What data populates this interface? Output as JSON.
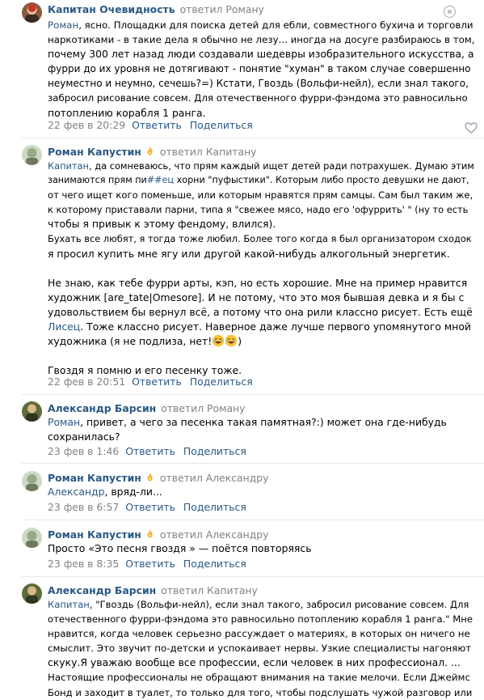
{
  "comments": [
    {
      "author": "Капитан Очевидность",
      "replied": "ответил Роману",
      "addressee": "Роман",
      "lines": [
        ", ясно. Площадки для поиска детей для ебли, совместного бухича и торговли",
        "наркотиками - в такие дела я обычно не лезу... иногда на досуге разбираюсь в том,",
        "почему 300 лет назад люди создавали шедевры изобразительного искусства, а",
        "фурри до их уровня не дотягивают - понятие \"хуман\" в таком случае совершенно",
        "неуместно и неумно, сечешь?=) Кстати, Гвоздь (Вольфи-нейл), если знал такого,",
        "забросил рисование совсем. Для отечественного фурри-фэндома это равносильно",
        "потоплению корабля 1 ранга."
      ],
      "date": "22 фев в 20:29",
      "reply": "Ответить",
      "share": "Поделиться"
    },
    {
      "author": "Роман Капустин",
      "replied": "ответил Капитану",
      "addressee": "Капитан",
      "line1_a": ", да сомневаюсь, что прям каждый ищет детей ради потрахушек. Думаю этим",
      "line2_a": "занимаются прям пи",
      "line2_tag": "##ец",
      "line2_b": " хорни \"пуфыстики\". Которым либо просто девушки не дают,",
      "lines_rest": [
        "от чего ищет кого поменьше, или которым нравятся прям самцы. Сам был таким же,",
        "к которому приставали парни, типа я \"свежее мясо, надо его 'офуррить' \" (ну то есть",
        "чтобы я привык к этому фендому, влился).",
        "Бухать все любят, я тогда тоже любил. Более того когда я был организатором сходок",
        "я просил купить мне ягу или другой какой-нибудь алкогольный энергетик."
      ],
      "para2_lines": [
        "Не знаю, как тебе фурри арты, кэп, но есть хорошие. Мне на пример нравится",
        "художник [are_tate|Omesore]. И не потому, что это моя бывшая девка и я бы с",
        "удовольствием бы вернул всё, а потому что она рили классно рисует. Есть ещё"
      ],
      "para2_link": "Лисец",
      "para2_after_link": ". Тоже классно рисует. Наверное даже лучше первого упомянутого мной",
      "para2_last": "художника (я не подлиза, нет!",
      "para2_last_end": ")",
      "para3": "Гвоздя я помню и его песенку тоже.",
      "date": "22 фев в 20:51",
      "reply": "Ответить",
      "share": "Поделиться"
    },
    {
      "author": "Александр Барсин",
      "replied": "ответил Роману",
      "addressee": "Роман",
      "lines": [
        ", привет, а чего за песенка такая памятная?:) может она где-нибудь",
        "сохранилась?"
      ],
      "date": "23 фев в 1:46",
      "reply": "Ответить",
      "share": "Поделиться"
    },
    {
      "author": "Роман Капустин",
      "replied": "ответил Александру",
      "addressee": "Александр",
      "lines": [
        ", вряд-ли..."
      ],
      "date": "23 фев в 6:57",
      "reply": "Ответить",
      "share": "Поделиться"
    },
    {
      "author": "Роман Капустин",
      "replied": "ответил Александру",
      "lines": [
        "Просто «Это песня гвоздя » — поётся повторяясь"
      ],
      "date": "23 фев в 8:35",
      "reply": "Ответить",
      "share": "Поделиться"
    },
    {
      "author": "Александр Барсин",
      "replied": "ответил Капитану",
      "addressee": "Капитан",
      "lines": [
        ", \"Гвоздь (Вольфи-нейл), если знал такого, забросил рисование совсем. Для",
        "отечественного фурри-фэндома это равносильно потоплению корабля 1 ранга.\" Мне",
        "нравится, когда человек серьезно рассуждает о материях, в которых он ничего не",
        "смыслит. Это звучит по-детски и успокаивает нервы. Узкие специалисты нагоняют",
        "скуку.Я уважаю вообще все профессии, если человек в них профессионал. ...",
        "Настоящие профессионалы не обращают внимания на такие мелочи. Если Джеймс",
        "Бонд и заходит в туалет, то только для того, чтобы подслушать чужой разговор или"
      ]
    }
  ],
  "colors": {
    "link": "#2a5885",
    "meta": "#828282",
    "separator": "#e7e8ec"
  },
  "icons": [
    "close-icon",
    "heart-icon",
    "fire-badge-icon",
    "rofl-emoji"
  ]
}
